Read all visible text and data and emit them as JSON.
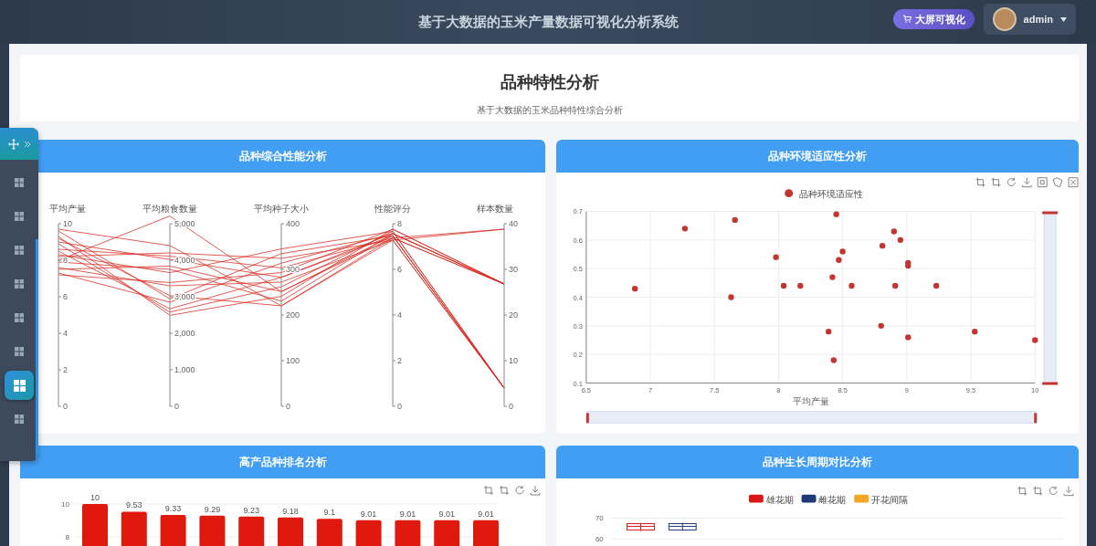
{
  "header": {
    "title": "基于大数据的玉米产量数据可视化分析系统",
    "screen_button": "大屏可视化",
    "user": "admin"
  },
  "sidebar": {
    "items": [
      {
        "selected": false
      },
      {
        "selected": false
      },
      {
        "selected": false
      },
      {
        "selected": false
      },
      {
        "selected": false
      },
      {
        "selected": false
      },
      {
        "selected": true
      },
      {
        "selected": false
      }
    ]
  },
  "page": {
    "title": "品种特性分析",
    "subtitle": "基于大数据的玉米品种特性综合分析"
  },
  "panels": [
    {
      "kind": "parallel",
      "title": "品种综合性能分析",
      "axes": [
        {
          "name": "平均产量",
          "ticks": [
            "10",
            "8",
            "6",
            "4",
            "2",
            "0"
          ]
        },
        {
          "name": "平均粮食数量",
          "ticks": [
            "5,000",
            "4,000",
            "3,000",
            "2,000",
            "1,000",
            "0"
          ]
        },
        {
          "name": "平均种子大小",
          "ticks": [
            "400",
            "300",
            "200",
            "100",
            "0"
          ]
        },
        {
          "name": "性能评分",
          "ticks": [
            "8",
            "6",
            "4",
            "2",
            "0"
          ]
        },
        {
          "name": "样本数量",
          "ticks": [
            "40",
            "30",
            "20",
            "10",
            "0"
          ]
        }
      ]
    },
    {
      "kind": "scatter",
      "title": "品种环境适应性分析",
      "chart_data": {
        "type": "scatter",
        "xlabel": "平均产量",
        "xlim": [
          6.5,
          10
        ],
        "ylim": [
          0.1,
          0.7
        ],
        "xticks": [
          6.5,
          7,
          7.5,
          8,
          8.5,
          9,
          9.5,
          10
        ],
        "yticks": [
          0.1,
          0.2,
          0.3,
          0.4,
          0.5,
          0.6,
          0.7
        ],
        "grid": true,
        "x": [
          6.88,
          7.27,
          7.66,
          7.63,
          7.98,
          8.04,
          8.17,
          8.45,
          8.5,
          8.47,
          8.42,
          8.57,
          8.39,
          8.43,
          8.8,
          8.81,
          8.9,
          8.95,
          9.01,
          9.01,
          8.91,
          9.23,
          9.01,
          9.53,
          10
        ],
        "series": [
          {
            "name": "品种环境适应性",
            "color": "#c23531",
            "values": [
              0.43,
              0.64,
              0.67,
              0.4,
              0.54,
              0.44,
              0.44,
              0.69,
              0.56,
              0.53,
              0.47,
              0.44,
              0.28,
              0.18,
              0.3,
              0.58,
              0.63,
              0.6,
              0.52,
              0.51,
              0.44,
              0.44,
              0.26,
              0.28,
              0.25
            ]
          }
        ]
      }
    },
    {
      "kind": "bar",
      "title": "高产品种排名分析",
      "chart_data": {
        "type": "bar",
        "values": [
          10,
          9.53,
          9.33,
          9.29,
          9.23,
          9.18,
          9.1,
          9.01,
          9.01,
          9.01,
          9.01
        ],
        "data_labels": true,
        "ylim": [
          0,
          10
        ],
        "yticks": [
          8,
          10
        ]
      }
    },
    {
      "kind": "boxplot",
      "title": "品种生长周期对比分析",
      "legend": [
        {
          "label": "雄花期",
          "color": "#d7191c"
        },
        {
          "label": "雌花期",
          "color": "#1f3a78"
        },
        {
          "label": "开花间隔",
          "color": "#f5a623"
        }
      ],
      "y_ticks": [
        "70",
        "60"
      ]
    }
  ]
}
